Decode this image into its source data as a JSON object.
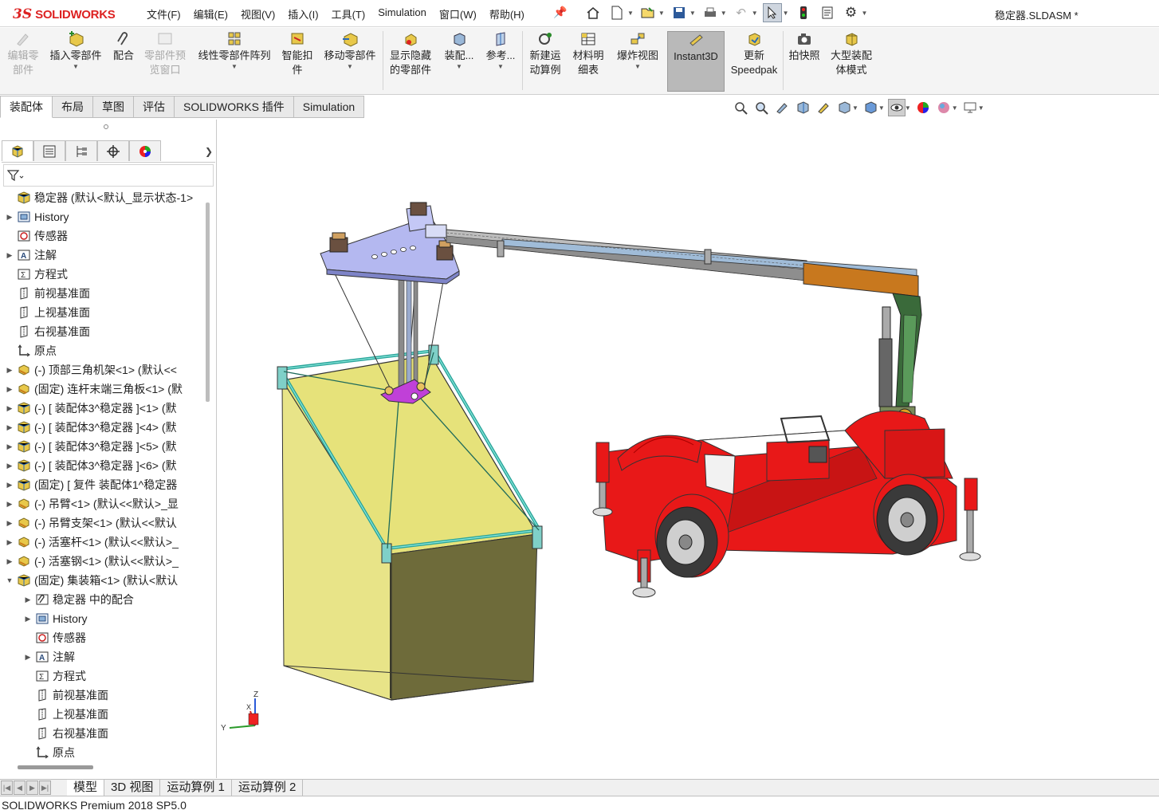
{
  "app": {
    "logo_ds": "3S",
    "logo_name": "SOLIDWORKS",
    "doc_title": "稳定器.SLDASM *"
  },
  "menu": [
    "文件(F)",
    "编辑(E)",
    "视图(V)",
    "插入(I)",
    "工具(T)",
    "Simulation",
    "窗口(W)",
    "帮助(H)"
  ],
  "commands": [
    {
      "label1": "编辑零",
      "label2": "部件",
      "disabled": true
    },
    {
      "label1": "插入零部件",
      "label2": "",
      "disabled": false
    },
    {
      "label1": "配合",
      "label2": "",
      "disabled": false
    },
    {
      "label1": "零部件预",
      "label2": "览窗口",
      "disabled": true
    },
    {
      "label1": "线性零部件阵列",
      "label2": "",
      "disabled": false
    },
    {
      "label1": "智能扣",
      "label2": "件",
      "disabled": false
    },
    {
      "label1": "移动零部件",
      "label2": "",
      "disabled": false
    },
    {
      "label1": "显示隐藏",
      "label2": "的零部件",
      "disabled": false
    },
    {
      "label1": "装配...",
      "label2": "",
      "disabled": false
    },
    {
      "label1": "参考...",
      "label2": "",
      "disabled": false
    },
    {
      "label1": "新建运",
      "label2": "动算例",
      "disabled": false
    },
    {
      "label1": "材料明",
      "label2": "细表",
      "disabled": false
    },
    {
      "label1": "爆炸视图",
      "label2": "",
      "disabled": false
    },
    {
      "label1": "Instant3D",
      "label2": "",
      "disabled": false
    },
    {
      "label1": "更新",
      "label2": "Speedpak",
      "disabled": false
    },
    {
      "label1": "拍快照",
      "label2": "",
      "disabled": false
    },
    {
      "label1": "大型装配",
      "label2": "体模式",
      "disabled": false
    }
  ],
  "tabs": [
    "装配体",
    "布局",
    "草图",
    "评估",
    "SOLIDWORKS 插件",
    "Simulation"
  ],
  "tree": [
    {
      "label": "稳定器  (默认<默认_显示状态-1>",
      "icon": "assembly-icon",
      "expand": ""
    },
    {
      "label": "History",
      "icon": "history-icon",
      "expand": "▶"
    },
    {
      "label": "传感器",
      "icon": "sensor-icon",
      "expand": ""
    },
    {
      "label": "注解",
      "icon": "annotation-icon",
      "expand": "▶"
    },
    {
      "label": "方程式",
      "icon": "equation-icon",
      "expand": ""
    },
    {
      "label": "前视基准面",
      "icon": "plane-icon",
      "expand": ""
    },
    {
      "label": "上视基准面",
      "icon": "plane-icon",
      "expand": ""
    },
    {
      "label": "右视基准面",
      "icon": "plane-icon",
      "expand": ""
    },
    {
      "label": "原点",
      "icon": "origin-icon",
      "expand": ""
    },
    {
      "label": "(-) 顶部三角机架<1> (默认<<",
      "icon": "part-icon",
      "expand": "▶"
    },
    {
      "label": "(固定) 连杆末端三角板<1> (默",
      "icon": "part-icon",
      "expand": "▶"
    },
    {
      "label": "(-) [ 装配体3^稳定器 ]<1> (默",
      "icon": "subassembly-icon",
      "expand": "▶"
    },
    {
      "label": "(-) [ 装配体3^稳定器 ]<4> (默",
      "icon": "subassembly-icon",
      "expand": "▶"
    },
    {
      "label": "(-) [ 装配体3^稳定器 ]<5> (默",
      "icon": "subassembly-icon",
      "expand": "▶"
    },
    {
      "label": "(-) [ 装配体3^稳定器 ]<6> (默",
      "icon": "subassembly-icon",
      "expand": "▶"
    },
    {
      "label": "(固定) [ 复件 装配体1^稳定器",
      "icon": "subassembly-icon",
      "expand": "▶"
    },
    {
      "label": "(-) 吊臂<1> (默认<<默认>_显",
      "icon": "part-icon",
      "expand": "▶"
    },
    {
      "label": "(-) 吊臂支架<1> (默认<<默认",
      "icon": "part-icon",
      "expand": "▶"
    },
    {
      "label": "(-) 活塞杆<1> (默认<<默认>_",
      "icon": "part-icon",
      "expand": "▶"
    },
    {
      "label": "(-) 活塞钢<1> (默认<<默认>_",
      "icon": "part-icon",
      "expand": "▶"
    },
    {
      "label": "(固定) 集装箱<1> (默认<默认",
      "icon": "subassembly-icon",
      "expand": "▼"
    },
    {
      "label": "稳定器 中的配合",
      "icon": "mates-icon",
      "expand": "▶"
    },
    {
      "label": "History",
      "icon": "history-icon",
      "expand": "▶"
    },
    {
      "label": "传感器",
      "icon": "sensor-icon",
      "expand": ""
    },
    {
      "label": "注解",
      "icon": "annotation-icon",
      "expand": "▶"
    },
    {
      "label": "方程式",
      "icon": "equation-icon",
      "expand": ""
    },
    {
      "label": "前视基准面",
      "icon": "plane-icon",
      "expand": ""
    },
    {
      "label": "上视基准面",
      "icon": "plane-icon",
      "expand": ""
    },
    {
      "label": "右视基准面",
      "icon": "plane-icon",
      "expand": ""
    },
    {
      "label": "原点",
      "icon": "origin-icon",
      "expand": ""
    }
  ],
  "triad": {
    "x": "X",
    "y": "Y",
    "z": "Z"
  },
  "bottom_tabs": [
    "模型",
    "3D 视图",
    "运动算例 1",
    "运动算例 2"
  ],
  "status": "SOLIDWORKS Premium 2018 SP5.0",
  "colors": {
    "brand": "#d22222",
    "container": "#e6e27a",
    "crane_body": "#e81818",
    "boom": "#b4b4b4",
    "boom_orange": "#c8781e"
  }
}
